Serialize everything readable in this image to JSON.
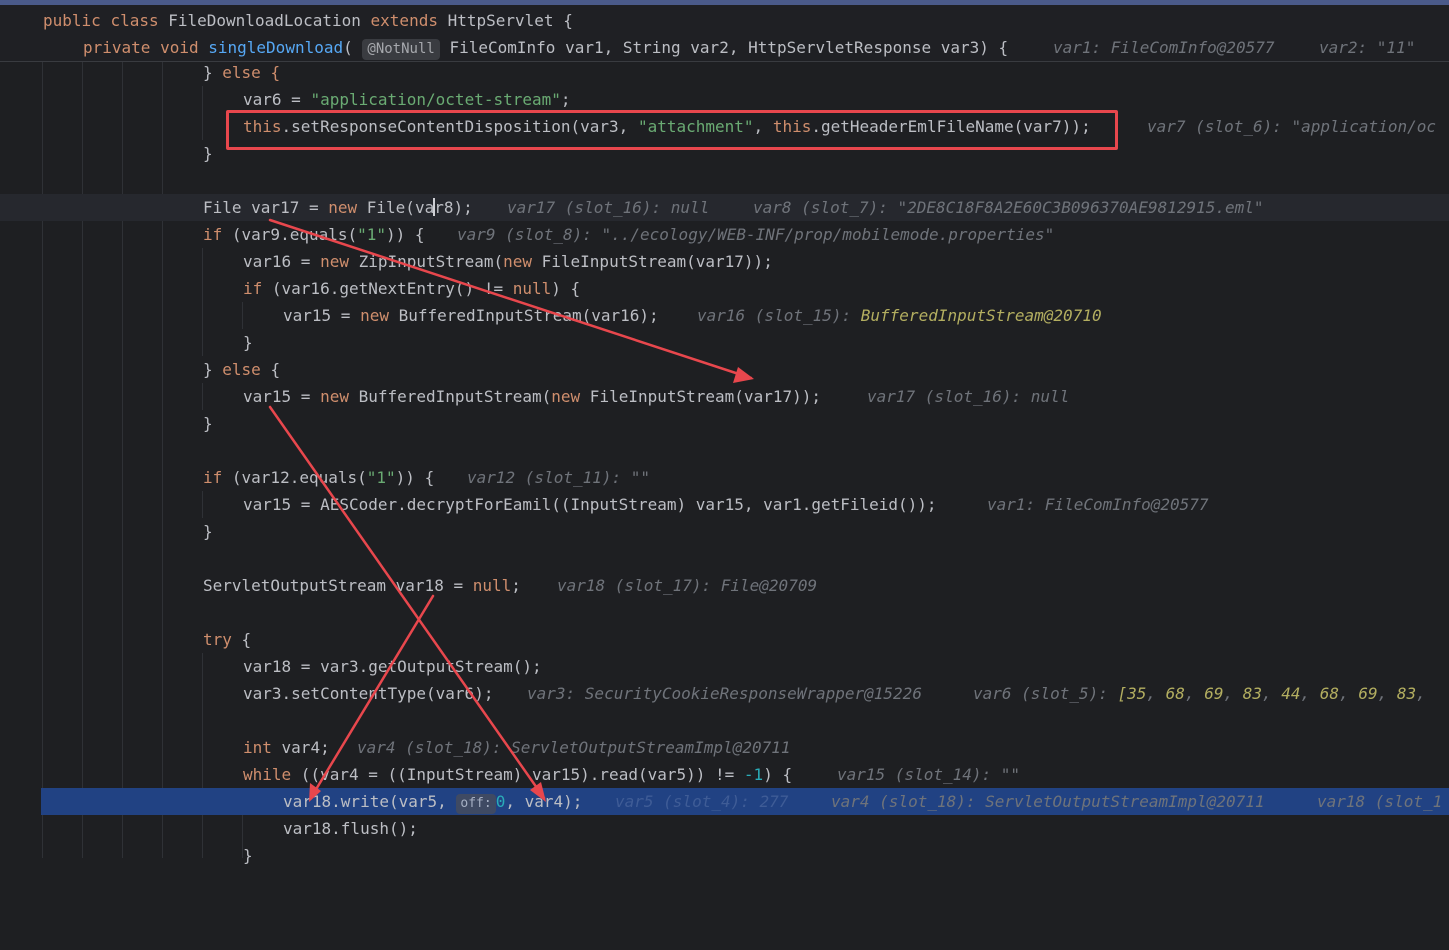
{
  "sticky": {
    "class_line": {
      "kw_public": "public",
      "kw_class": "class",
      "class_name": " FileDownloadLocation ",
      "kw_extends": "extends",
      "parent": " HttpServlet {"
    },
    "method_line": {
      "kw_private": "private",
      "kw_void": "void",
      "method_name": "singleDownload",
      "open_paren": "(",
      "annotation": "@NotNull",
      "params": "FileComInfo var1, String var2, HttpServletResponse var3) {",
      "hint1": "var1: FileComInfo@20577",
      "hint2": "var2: \"11\""
    }
  },
  "lines": {
    "l1": {
      "kw_else": "} else {",
      "a": "}",
      "b": " else {"
    },
    "l2": {
      "a": "var6 = ",
      "str": "\"application/octet-stream\"",
      "b": ";"
    },
    "l3": {
      "this1": "this",
      "a": ".setResponseContentDisposition(var3, ",
      "str": "\"attachment\"",
      "b": ", ",
      "this2": "this",
      "c": ".getHeaderEmlFileName(var7));",
      "hint": "var7 (slot_6): \"application/oc"
    },
    "l4": {
      "a": "}"
    },
    "l6": {
      "a": "File var17 = ",
      "kw": "new",
      "b": " File(va",
      "c": "r8);",
      "hint1": "var17 (slot_16): null",
      "hint2": "var8 (slot_7): \"2DE8C18F8A2E60C3B096370AE9812915.eml\""
    },
    "l7": {
      "kw": "if",
      "a": " (var9.equals(",
      "str": "\"1\"",
      "b": ")) {",
      "hint": "var9 (slot_8): \"../ecology/WEB-INF/prop/mobilemode.properties\""
    },
    "l8": {
      "a": "var16 = ",
      "kw1": "new",
      "b": " ZipInputStream(",
      "kw2": "new",
      "c": " FileInputStream(var17));"
    },
    "l9": {
      "kw": "if",
      "a": " (var16.getNextEntry() != ",
      "kw2": "null",
      "b": ") {"
    },
    "l10": {
      "a": "var15 = ",
      "kw": "new",
      "b": " BufferedInputStream(var16);",
      "hint_a": "var16 (slot_15): ",
      "hint_b": "BufferedInputStream@20710"
    },
    "l11": {
      "a": "}"
    },
    "l12": {
      "a": "}",
      "kw": " else",
      "b": " {"
    },
    "l13": {
      "a": "var15 = ",
      "kw1": "new",
      "b": " BufferedInputStream(",
      "kw2": "new",
      "c": " FileInputStream(var17));",
      "hint": "var17 (slot_16): null"
    },
    "l14": {
      "a": "}"
    },
    "l16": {
      "kw": "if",
      "a": " (var12.equals(",
      "str": "\"1\"",
      "b": ")) {",
      "hint": "var12 (slot_11): \"\""
    },
    "l17": {
      "a": "var15 = AESCoder.decryptForEamil((InputStream) var15, var1.getFileid());",
      "hint": "var1: FileComInfo@20577"
    },
    "l18": {
      "a": "}"
    },
    "l20": {
      "a": "ServletOutputStream var18 = ",
      "kw": "null",
      "b": ";",
      "hint": "var18 (slot_17): File@20709"
    },
    "l22": {
      "kw": "try",
      "a": " {"
    },
    "l23": {
      "a": "var18 = var3.getOutputStream();"
    },
    "l24": {
      "a": "var3.setContentType(var6);",
      "hint1": "var3: SecurityCookieResponseWrapper@15226",
      "hint2": "var6 (slot_5): ",
      "arr_open": "[",
      "n1": "35",
      "n2": "68",
      "n3": "69",
      "n4": "83",
      "n5": "44",
      "n6": "68",
      "n7": "69",
      "n8": "83",
      "sep": ", "
    },
    "l26": {
      "kw": "int",
      "a": " var4;",
      "hint": "var4 (slot_18): ServletOutputStreamImpl@20711"
    },
    "l27": {
      "kw": "while",
      "a": " ((var4 = ((InputStream) var15).read(var5)) != ",
      "num": "-1",
      "b": ") {",
      "hint": "var15 (slot_14): \"\""
    },
    "l28": {
      "a": "var18.write(var5, ",
      "off": "off:",
      "num": "0",
      "b": ", var4);",
      "hint1": "var5 (slot_4): 277",
      "hint2": "var4 (slot_18): ServletOutputStreamImpl@20711",
      "hint3": "var18 (slot_1"
    },
    "l29": {
      "a": "var18.flush();"
    },
    "l30": {
      "a": "}"
    }
  }
}
